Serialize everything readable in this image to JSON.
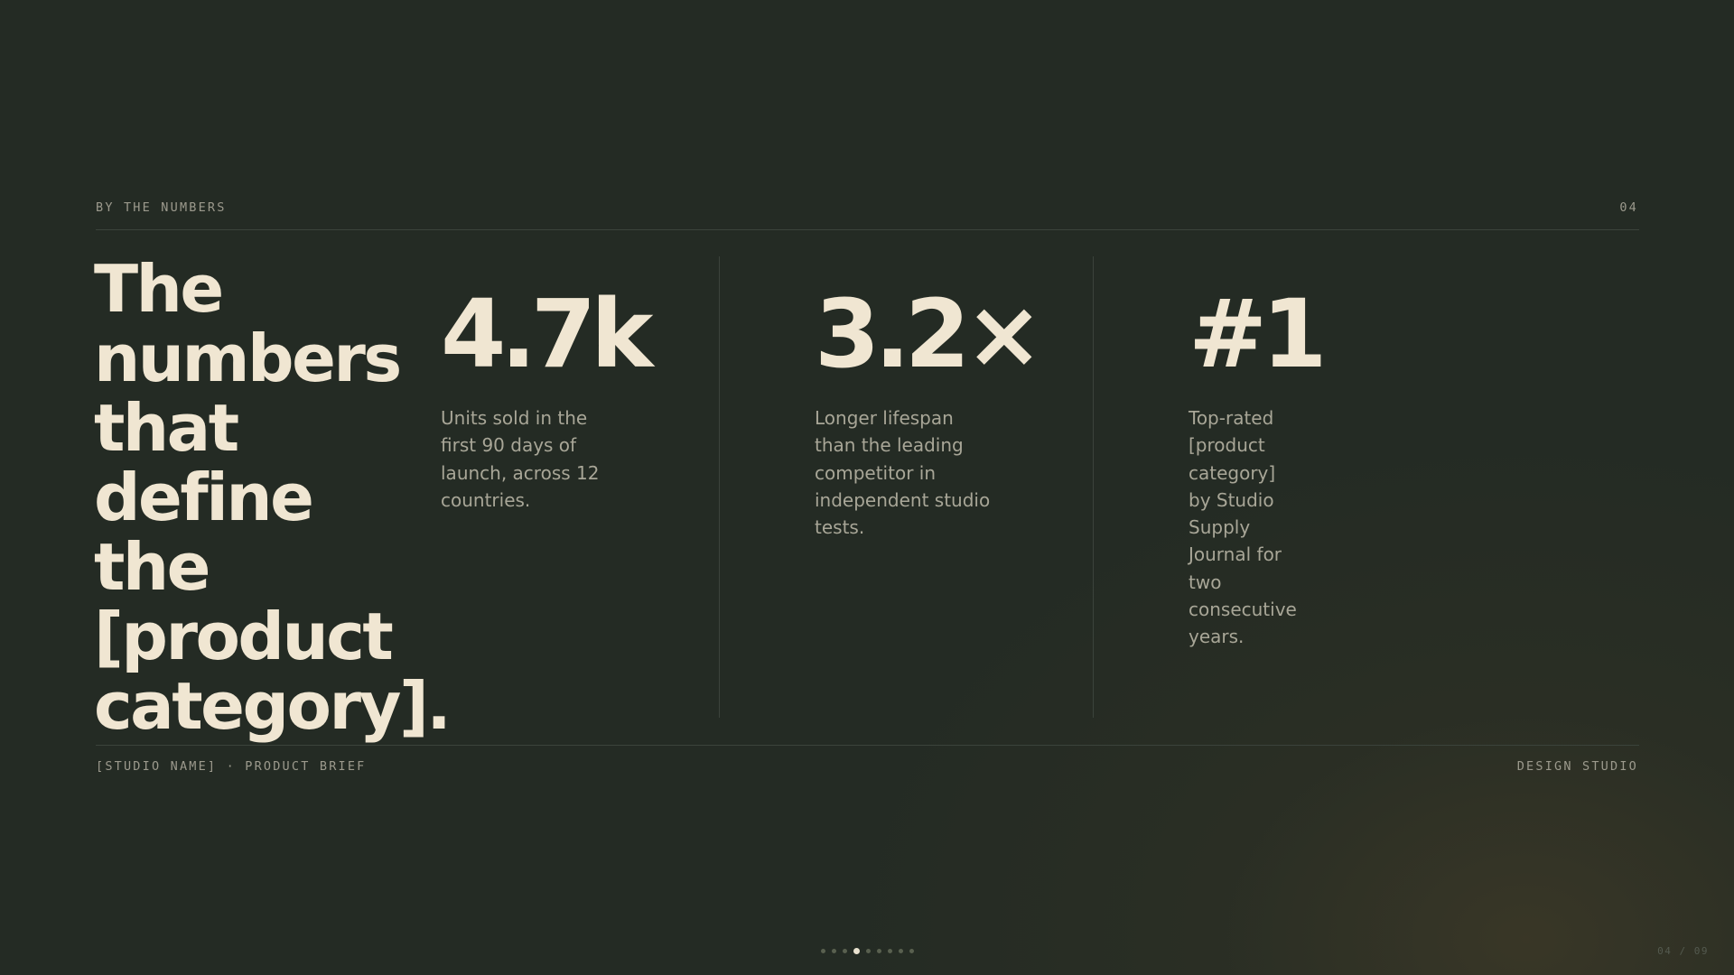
{
  "header": {
    "eyebrow": "BY THE NUMBERS",
    "page_number": "04"
  },
  "headline": "The numbers that define the [product category].",
  "stats": [
    {
      "value": "4.7k",
      "description": "Units sold in the first 90 days of launch, across 12 countries."
    },
    {
      "value": "3.2×",
      "description": "Longer lifespan than the leading competitor in independent studio tests."
    },
    {
      "value": "#1",
      "description": "Top-rated [product category] by Studio Supply Journal for two consecutive years."
    }
  ],
  "footer": {
    "left": "[STUDIO NAME] · PRODUCT BRIEF",
    "right": "DESIGN STUDIO"
  },
  "pagination": {
    "total_slides": 9,
    "current_slide": 4,
    "counter_text": "04 / 09"
  },
  "colors": {
    "background": "#242b24",
    "headline": "#f0e6d2",
    "body_text": "#a8a697",
    "muted_label": "#9c9a8d",
    "rule": "#3b433b",
    "active_dot": "#e8e1cf",
    "inactive_dot": "#59604f"
  }
}
